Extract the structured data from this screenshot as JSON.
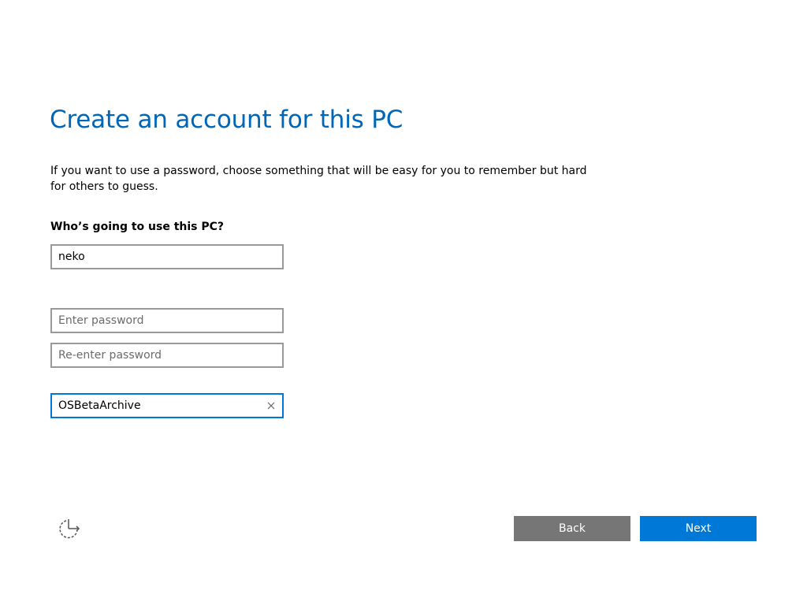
{
  "page": {
    "title": "Create an account for this PC",
    "description": "If you want to use a password, choose something that will be easy for you to remember but hard for others to guess.",
    "user_label": "Who’s going to use this PC?"
  },
  "form": {
    "username": {
      "value": "neko",
      "placeholder": ""
    },
    "password": {
      "value": "",
      "placeholder": "Enter password"
    },
    "password_confirm": {
      "value": "",
      "placeholder": "Re-enter password"
    },
    "password_hint": {
      "value": "OSBetaArchive",
      "placeholder": ""
    }
  },
  "footer": {
    "ease_of_access_icon": "ease-of-access-icon",
    "back_label": "Back",
    "next_label": "Next"
  },
  "colors": {
    "accent": "#0078d7",
    "title": "#0067b8",
    "back_button": "#767676",
    "field_border": "#999999"
  }
}
